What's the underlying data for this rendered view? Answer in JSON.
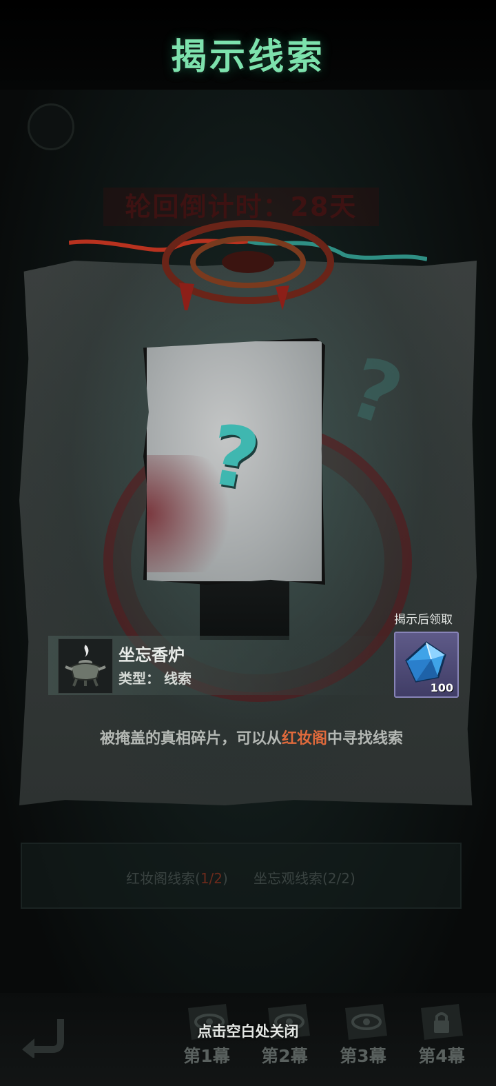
{
  "popup": {
    "title": "揭示线索",
    "reward": {
      "label": "揭示后领取",
      "icon": "blue-diamond-icon",
      "count": "100"
    },
    "item": {
      "icon": "incense-burner-icon",
      "name": "坐忘香炉",
      "type_label": "类型：",
      "type_value": "线索"
    },
    "description": {
      "before": "被掩盖的真相碎片，可以从",
      "highlight": "红妆阁",
      "after": "中寻找线索"
    },
    "close_hint": "点击空白处关闭"
  },
  "background": {
    "countdown": "轮回倒计时：28天",
    "clue_progress": [
      {
        "label": "红妆阁线索(",
        "count": "1/2",
        "suffix": ")"
      },
      {
        "label": "坐忘观线索(2/2)",
        "count": "",
        "suffix": ""
      }
    ]
  },
  "acts": [
    {
      "label": "第1幕",
      "icon": "eye-scroll-icon",
      "locked": false
    },
    {
      "label": "第2幕",
      "icon": "eye-scroll-icon",
      "locked": false
    },
    {
      "label": "第3幕",
      "icon": "eye-scroll-icon",
      "locked": false
    },
    {
      "label": "第4幕",
      "icon": "lock-icon",
      "locked": true
    }
  ],
  "colors": {
    "title": "#7de2ad",
    "highlight": "#e06a3c",
    "question_mark": "#3fb7b0",
    "reward_frame": "#5e5a88"
  }
}
